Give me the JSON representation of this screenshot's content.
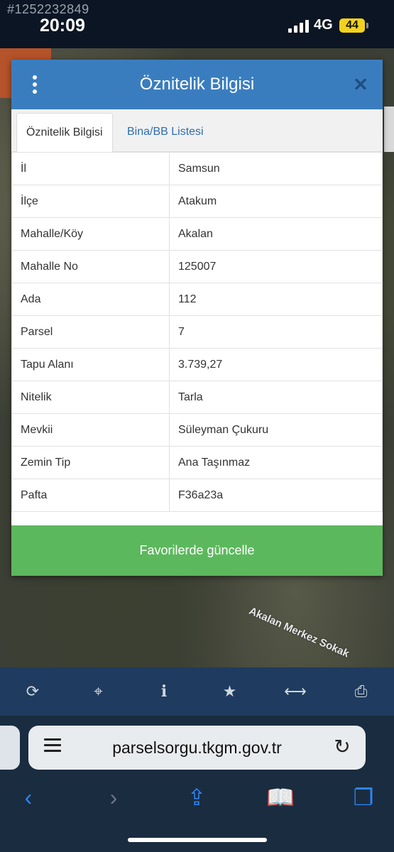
{
  "status_bar": {
    "watermark_id": "#1252232849",
    "time": "20:09",
    "network": "4G",
    "battery": "44"
  },
  "map": {
    "street_label": "Akalan Merkez Sokak"
  },
  "dialog": {
    "title": "Öznitelik Bilgisi",
    "tabs": [
      {
        "label": "Öznitelik Bilgisi",
        "active": true
      },
      {
        "label": "Bina/BB Listesi",
        "active": false
      }
    ],
    "rows": [
      {
        "key": "İl",
        "value": "Samsun"
      },
      {
        "key": "İlçe",
        "value": "Atakum"
      },
      {
        "key": "Mahalle/Köy",
        "value": "Akalan"
      },
      {
        "key": "Mahalle No",
        "value": "125007"
      },
      {
        "key": "Ada",
        "value": "112"
      },
      {
        "key": "Parsel",
        "value": "7"
      },
      {
        "key": "Tapu Alanı",
        "value": "3.739,27"
      },
      {
        "key": "Nitelik",
        "value": "Tarla"
      },
      {
        "key": "Mevkii",
        "value": "Süleyman Çukuru"
      },
      {
        "key": "Zemin Tip",
        "value": "Ana Taşınmaz"
      },
      {
        "key": "Pafta",
        "value": "F36a23a"
      }
    ],
    "update_button": "Favorilerde güncelle"
  },
  "toolbar": {
    "buttons": [
      {
        "icon": "refresh-icon",
        "glyph": "⟳"
      },
      {
        "icon": "crosshair-icon",
        "glyph": "⌖"
      },
      {
        "icon": "info-icon",
        "glyph": "i"
      },
      {
        "icon": "star-icon",
        "glyph": "★"
      },
      {
        "icon": "measure-icon",
        "glyph": "⟷"
      },
      {
        "icon": "print-icon",
        "glyph": "⎙"
      }
    ]
  },
  "browser": {
    "url": "parselsorgu.tkgm.gov.tr",
    "nav": [
      {
        "icon": "back-icon",
        "glyph": "‹"
      },
      {
        "icon": "forward-icon",
        "glyph": "›"
      },
      {
        "icon": "share-icon",
        "glyph": "⇪"
      },
      {
        "icon": "bookmarks-icon",
        "glyph": "📖"
      },
      {
        "icon": "tabs-icon",
        "glyph": "❐"
      }
    ]
  },
  "colors": {
    "header": "#3a7dbf",
    "button": "#5cb85c",
    "toolbar": "#1f3b5f",
    "safari_accent": "#2f86f6"
  }
}
